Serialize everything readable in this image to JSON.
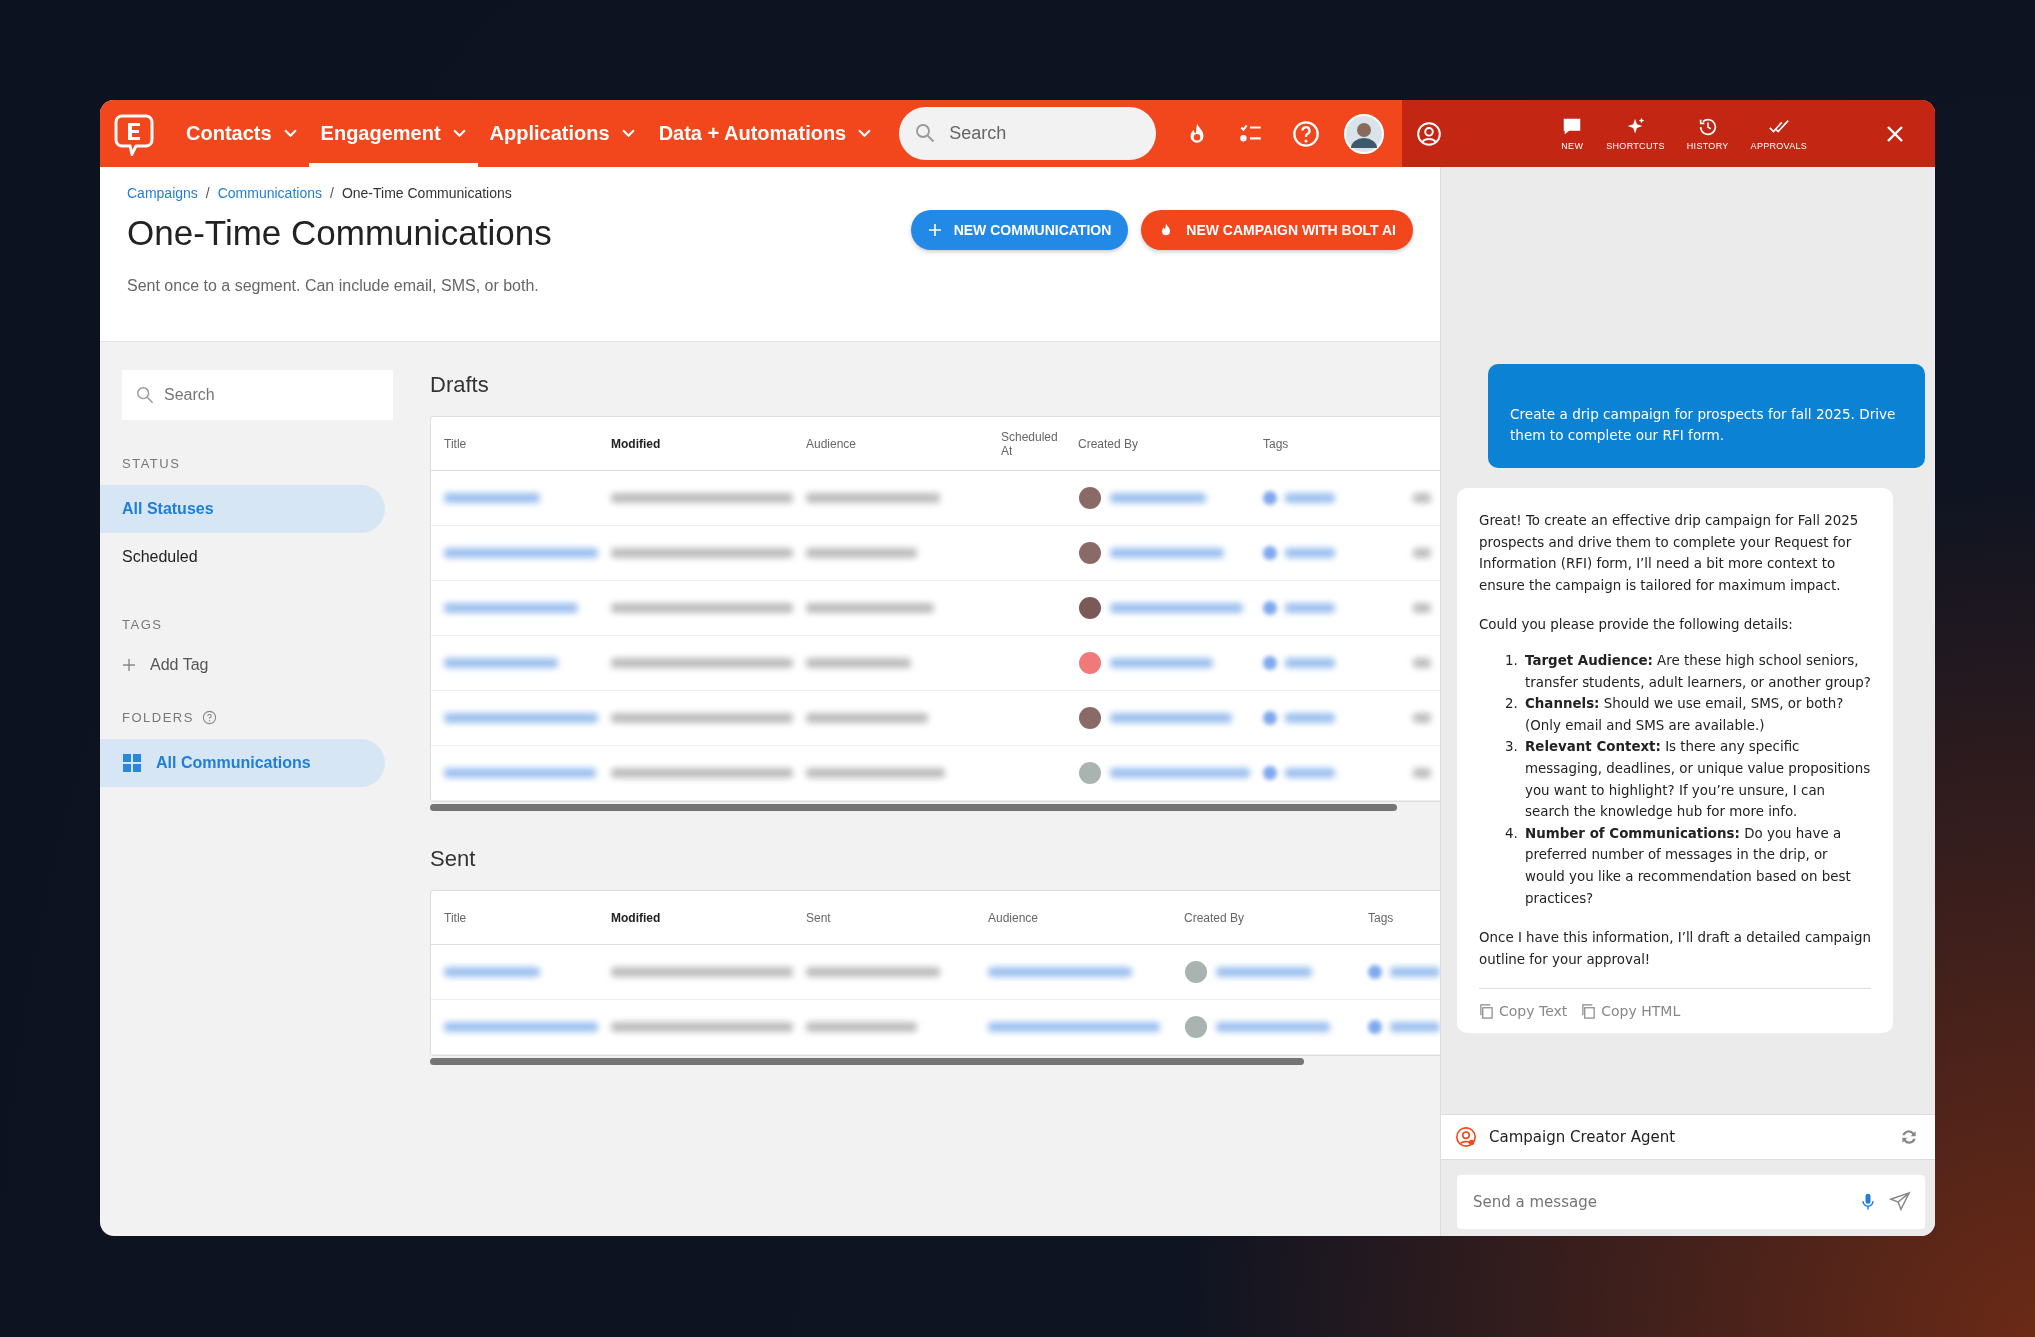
{
  "nav": {
    "items": [
      {
        "label": "Contacts",
        "selected": false
      },
      {
        "label": "Engagement",
        "selected": true
      },
      {
        "label": "Applications",
        "selected": false
      },
      {
        "label": "Data + Automations",
        "selected": false
      }
    ],
    "search": {
      "placeholder": "Search"
    }
  },
  "assistant_toolbar": {
    "items": [
      {
        "label": "NEW"
      },
      {
        "label": "SHORTCUTS"
      },
      {
        "label": "HISTORY"
      },
      {
        "label": "APPROVALS"
      }
    ]
  },
  "breadcrumb": [
    {
      "label": "Campaigns",
      "kind": "link"
    },
    {
      "label": "/",
      "kind": "separator"
    },
    {
      "label": "Communications",
      "kind": "link"
    },
    {
      "label": "/",
      "kind": "separator"
    },
    {
      "label": "One-Time Communications",
      "kind": "current"
    }
  ],
  "page": {
    "title": "One-Time Communications",
    "subtitle": "Sent once to a segment. Can include email, SMS, or both.",
    "buttons": [
      {
        "label": "NEW COMMUNICATION",
        "kind": "primary"
      },
      {
        "label": "NEW CAMPAIGN WITH BOLT AI",
        "kind": "ai"
      }
    ]
  },
  "sidebar": {
    "search": {
      "placeholder": "Search"
    },
    "status_heading": "STATUS",
    "statuses": [
      {
        "label": "All Statuses",
        "selected": true
      },
      {
        "label": "Scheduled",
        "selected": false
      }
    ],
    "tags_heading": "TAGS",
    "add_tag": "Add Tag",
    "folders_heading": "FOLDERS",
    "folders": [
      {
        "label": "All Communications",
        "selected": true
      }
    ]
  },
  "drafts": {
    "title": "Drafts",
    "columns": [
      {
        "label": "Title",
        "sorted": false
      },
      {
        "label": "Modified",
        "sorted": true
      },
      {
        "label": "Audience",
        "sorted": false
      },
      {
        "label": "Scheduled At",
        "sorted": false
      },
      {
        "label": "Created By",
        "sorted": false
      },
      {
        "label": "Tags",
        "sorted": false
      }
    ],
    "rows": [
      {
        "kind": "blurred",
        "color": "#8a6a66"
      },
      {
        "kind": "blurred",
        "color": "#8a6a66"
      },
      {
        "kind": "blurred",
        "color": "#7a5a56"
      },
      {
        "kind": "blurred",
        "color": "#f07a7a"
      },
      {
        "kind": "blurred",
        "color": "#8a6a66"
      },
      {
        "kind": "blurred",
        "color": "#a9b4b0"
      }
    ]
  },
  "sent": {
    "title": "Sent",
    "columns": [
      {
        "label": "Title",
        "sorted": false
      },
      {
        "label": "Modified",
        "sorted": true
      },
      {
        "label": "Sent",
        "sorted": false
      },
      {
        "label": "Audience",
        "sorted": false
      },
      {
        "label": "Created By",
        "sorted": false
      },
      {
        "label": "Tags",
        "sorted": false
      }
    ],
    "rows": [
      {
        "kind": "blurred",
        "color": "#a9b4b0"
      },
      {
        "kind": "blurred",
        "color": "#a9b4b0"
      }
    ]
  },
  "chat": {
    "user_message": "Create a drip campaign for prospects for fall 2025. Drive them to complete our RFI form.",
    "reply": {
      "intro": "Great! To create an effective drip campaign for Fall 2025 prospects and drive them to complete your Request for Information (RFI) form, I’ll need a bit more context to ensure the campaign is tailored for maximum impact.",
      "question": "Could you please provide the following details:",
      "list": [
        {
          "number": "1.",
          "text": "**Target Audience:** Are these high school seniors, transfer students, adult learners, or another group?"
        },
        {
          "number": "2.",
          "text": "**Channels:** Should we use email, SMS, or both? (Only email and SMS are available.)"
        },
        {
          "number": "3.",
          "text": "**Relevant Context:** Is there any specific messaging, deadlines, or unique value propositions you want to highlight? If you’re unsure, I can search the knowledge hub for more info."
        },
        {
          "number": "4.",
          "text": "**Number of Communications:** Do you have a preferred number of messages in the drip, or would you like a recommendation based on best practices?"
        }
      ],
      "closing": "Once I have this information, I’ll draft a detailed campaign outline for your approval!",
      "actions": [
        {
          "label": "Copy Text"
        },
        {
          "label": "Copy HTML"
        }
      ]
    },
    "agent": "Campaign Creator Agent",
    "input": {
      "placeholder": "Send a message"
    }
  }
}
